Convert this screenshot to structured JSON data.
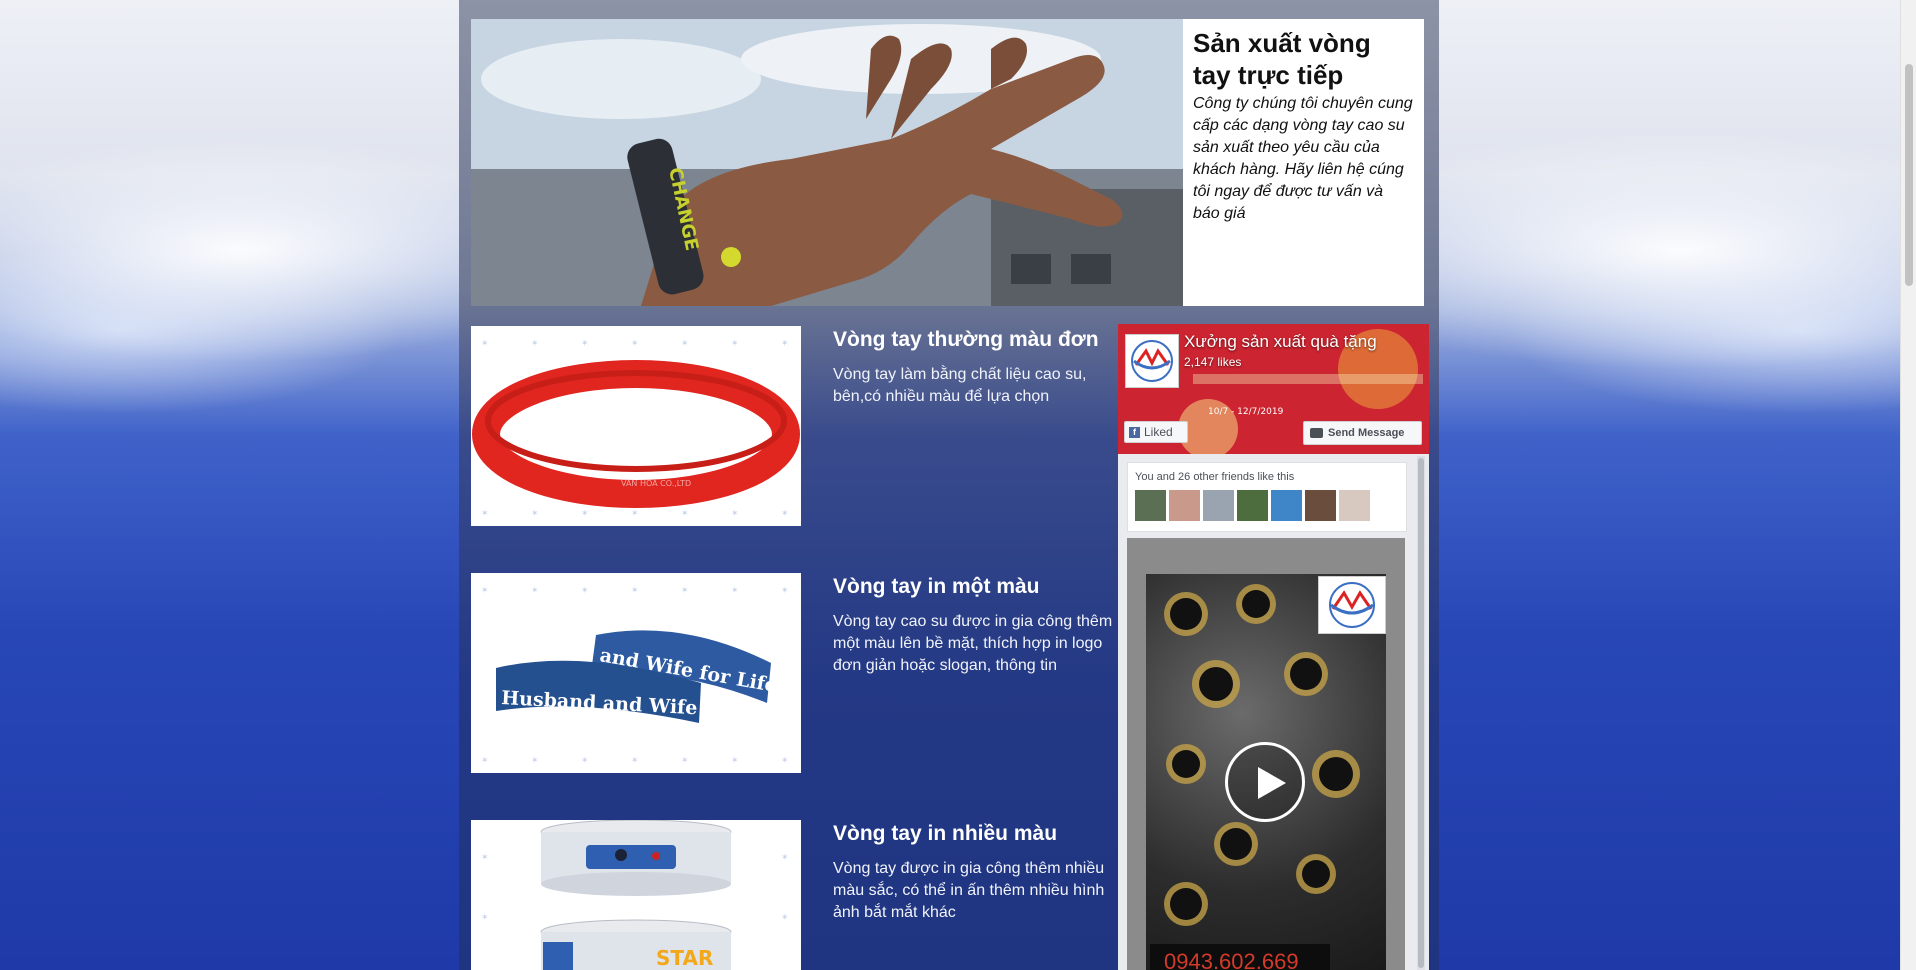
{
  "hero": {
    "title": "Sản xuất vòng tay trực tiếp",
    "description": "Công ty chúng tôi chuyên cung cấp các dạng vòng tay cao su sản xuất theo yêu cầu của khách hàng. Hãy liên hệ cúng tôi ngay để được tư vấn và báo giá",
    "image_text": "CHANGE"
  },
  "products": [
    {
      "title": "Vòng tay thường màu đơn",
      "description": "Vòng tay làm bằng chất liệu cao su, bên,có nhiều màu để lựa chọn",
      "image_text": "VAN HOA CO.,LTD"
    },
    {
      "title": "Vòng tay in một màu",
      "description": "Vòng tay cao su được in gia công thêm một màu lên bề mặt, thích hợp in logo đơn giản hoặc slogan, thông tin",
      "image_text_1": "and Wife for Life",
      "image_text_2": "Husband and Wife"
    },
    {
      "title": "Vòng tay in nhiều màu",
      "description": "Vòng tay được in gia công thêm nhiều màu sắc, có thể in ấn thêm nhiều hình ảnh bắt mắt khác",
      "image_text": "STAR"
    }
  ],
  "facebook": {
    "page_name": "Xưởng sản xuất quà tặng",
    "likes": "2,147 likes",
    "liked_label": "Liked",
    "send_label": "Send Message",
    "friends_text": "You and 26 other friends like this",
    "cover_date": "10/7 - 12/7/2019",
    "phone": "0943.602.669"
  },
  "colors": {
    "fb_blue": "#3b5998",
    "product_red": "#e0261f",
    "product_blue": "#2d5aa0"
  }
}
